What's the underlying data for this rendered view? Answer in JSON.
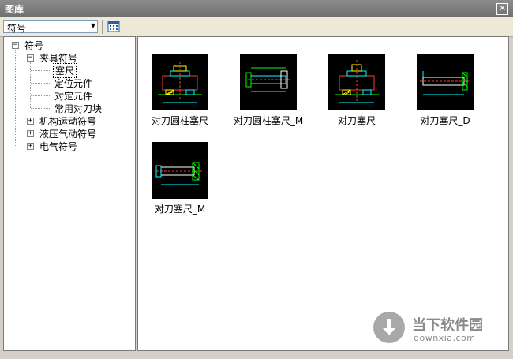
{
  "window": {
    "title": "图库",
    "close_glyph": "✕"
  },
  "toolbar": {
    "combo_value": "符号",
    "combo_arrow": "▼"
  },
  "tree": {
    "root": {
      "label": "符号",
      "expander": "−"
    },
    "fixture": {
      "label": "夹具符号",
      "expander": "−"
    },
    "fixture_children": [
      "塞尺",
      "定位元件",
      "对定元件",
      "常用对刀块"
    ],
    "others": [
      {
        "label": "机构运动符号",
        "expander": "+"
      },
      {
        "label": "液压气动符号",
        "expander": "+"
      },
      {
        "label": "电气符号",
        "expander": "+"
      }
    ]
  },
  "items": [
    {
      "label": "对刀圆柱塞尺"
    },
    {
      "label": "对刀圆柱塞尺_M"
    },
    {
      "label": "对刀塞尺"
    },
    {
      "label": "对刀塞尺_D"
    },
    {
      "label": "对刀塞尺_M"
    }
  ],
  "watermark": {
    "title": "当下软件园",
    "url": "downxia.com"
  }
}
